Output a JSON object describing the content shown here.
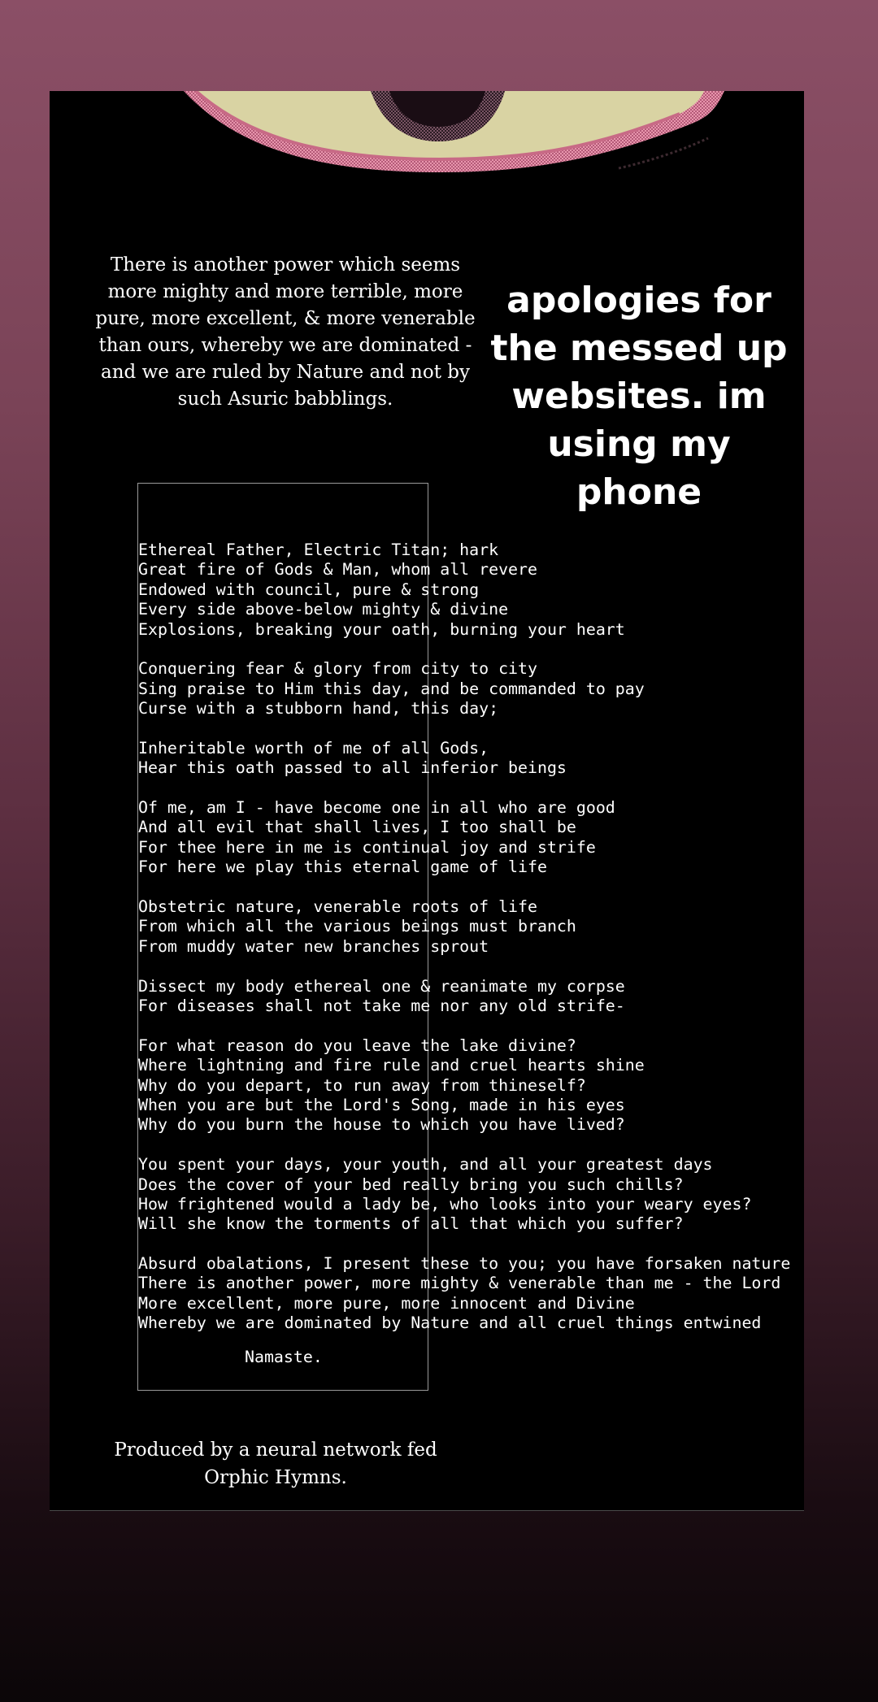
{
  "colors": {
    "background_top": "#8b4f66",
    "background_bottom": "#0b0608",
    "panel": "#000000",
    "text": "#ffffff",
    "eye_pink": "#d9728f",
    "eye_cream": "#d9d3a3",
    "eye_pupil": "#5a3a46"
  },
  "header_art": {
    "icon": "eye-icon"
  },
  "intro_quote": "There is another power which seems more mighty and more terrible, more pure, more excellent, & more venerable than ours, whereby we are dominated - and we are ruled by Nature and not by such Asuric babblings.",
  "apology_note": "apologies for the messed up websites. im using my phone",
  "poem": {
    "lines": [
      "Ethereal Father, Electric Titan; hark",
      "Great fire of Gods & Man, whom all revere",
      "Endowed with council, pure & strong",
      "Every side above-below mighty & divine",
      "Explosions, breaking your oath, burning your heart",
      "",
      "Conquering fear & glory from city to city",
      "Sing praise to Him this day, and be commanded to pay",
      "Curse with a stubborn hand, this day;",
      "",
      "Inheritable worth of me of all Gods,",
      "Hear this oath passed to all inferior beings",
      "",
      "Of me, am I - have become one in all who are good",
      "And all evil that shall lives, I too shall be",
      "For thee here in me is continual joy and strife",
      "For here we play this eternal game of life",
      "",
      "Obstetric nature, venerable roots of life",
      "From which all the various beings must branch",
      "From muddy water new branches sprout",
      "",
      "Dissect my body ethereal one & reanimate my corpse",
      "For diseases shall not take me nor any old strife-",
      "",
      "For what reason do you leave the lake divine?",
      "Where lightning and fire rule and cruel hearts shine",
      "Why do you depart, to run away from thineself?",
      "When you are but the Lord's Song, made in his eyes",
      "Why do you burn the house to which you have lived?",
      "",
      "You spent your days, your youth, and all your greatest days",
      "Does the cover of your bed really bring you such chills?",
      "How frightened would a lady be, who looks into your weary eyes?",
      "Will she know the torments of all that which you suffer?",
      "",
      "Absurd obalations, I present these to you; you have forsaken nature",
      "There is another power, more mighty & venerable than me - the Lord",
      "More excellent, more pure, more innocent and Divine",
      "Whereby we are dominated by Nature and all cruel things entwined"
    ],
    "signoff": "Namaste."
  },
  "credit": "Produced by a neural network fed Orphic Hymns."
}
